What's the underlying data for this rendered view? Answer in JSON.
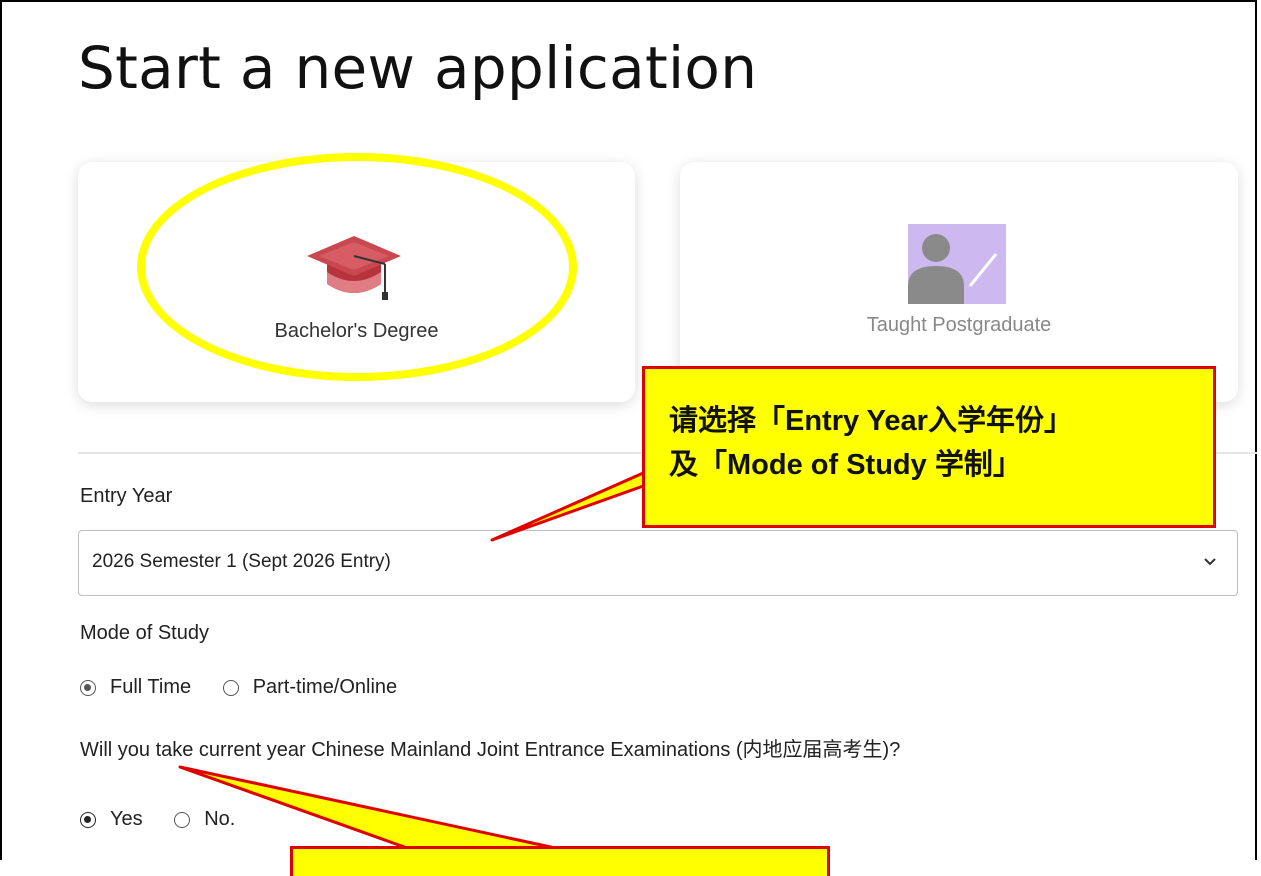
{
  "page": {
    "title": "Start a new application"
  },
  "cards": [
    {
      "label": "Bachelor's Degree",
      "icon": "graduation-cap-icon",
      "selected": true
    },
    {
      "label": "Taught Postgraduate",
      "icon": "teacher-icon",
      "selected": false
    }
  ],
  "entry_year": {
    "label": "Entry Year",
    "value": "2026 Semester 1 (Sept 2026 Entry)"
  },
  "mode_of_study": {
    "label": "Mode of Study",
    "options": [
      {
        "label": "Full Time",
        "checked": true
      },
      {
        "label": "Part-time/Online",
        "checked": false
      }
    ]
  },
  "exam_question": {
    "label": "Will you take current year Chinese Mainland Joint Entrance Examinations (内地应届高考生)?",
    "options": [
      {
        "label": "Yes",
        "checked": true
      },
      {
        "label": "No.",
        "checked": false
      }
    ]
  },
  "annotation": {
    "line1": "请选择「Entry Year入学年份」",
    "line2": "及「Mode of Study 学制」"
  },
  "colors": {
    "highlight": "#ffff00",
    "callout_border": "#e00000",
    "cap_red": "#c9484f",
    "teacher_purple": "#cdb8f0"
  }
}
